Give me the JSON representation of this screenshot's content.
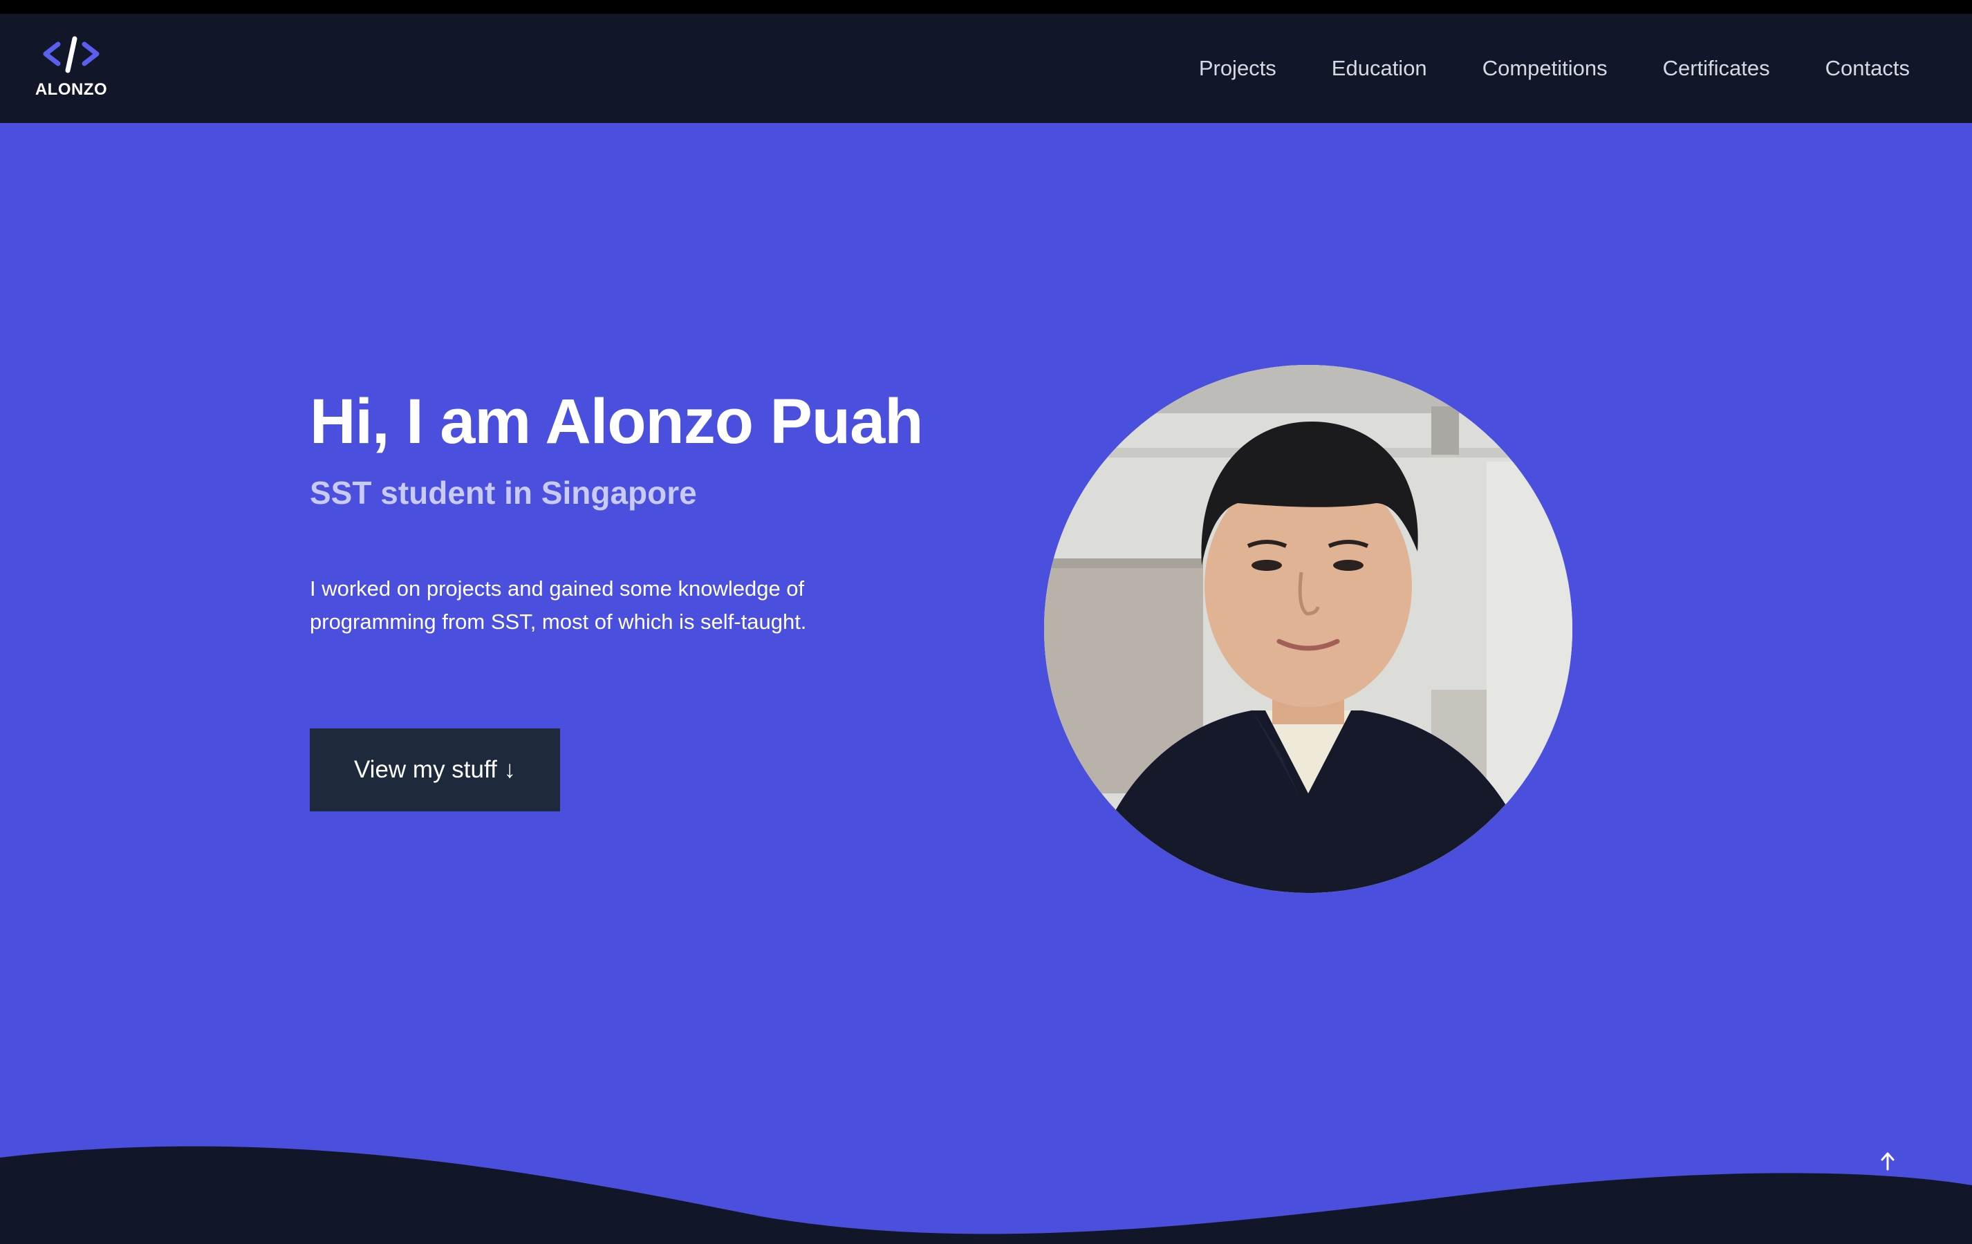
{
  "brand": {
    "logo_symbol": "</>",
    "name": "ALONZO",
    "accent_color": "#4b4fde"
  },
  "nav": {
    "items": [
      {
        "label": "Projects"
      },
      {
        "label": "Education"
      },
      {
        "label": "Competitions"
      },
      {
        "label": "Certificates"
      },
      {
        "label": "Contacts"
      }
    ]
  },
  "hero": {
    "title": "Hi, I am Alonzo Puah",
    "subtitle": "SST student in Singapore",
    "description": "I worked on projects and gained some knowledge of programming from SST, most of which is self-taught.",
    "button_label": "View my stuff ↓",
    "background_color": "#4b4fde"
  },
  "footer": {
    "scroll_top_icon": "arrow-up-icon",
    "wave_color": "#111729"
  }
}
